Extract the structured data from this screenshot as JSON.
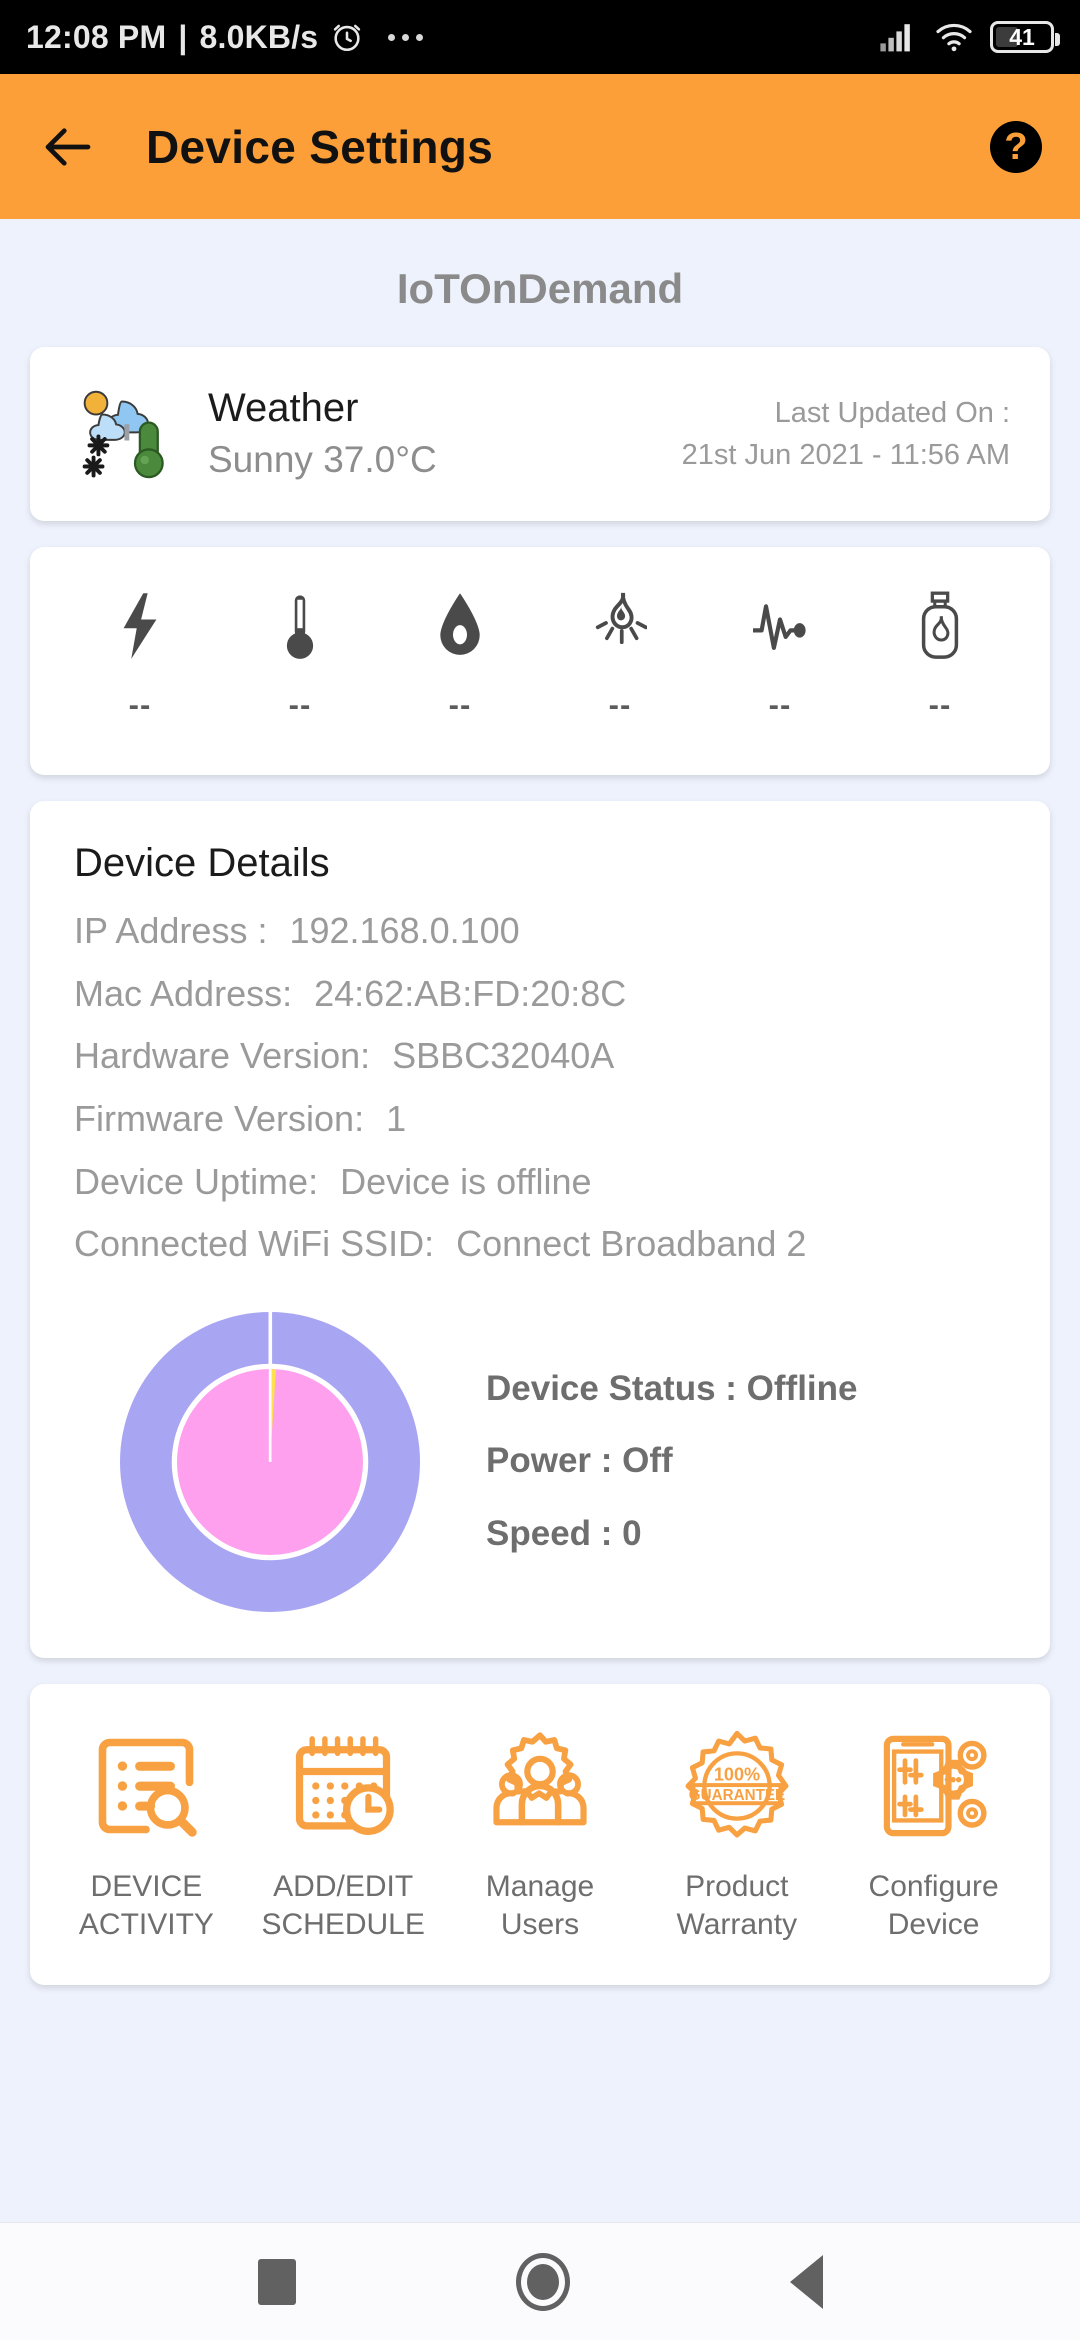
{
  "status_bar": {
    "time": "12:08 PM",
    "separator": "|",
    "network_speed": "8.0KB/s",
    "alarm_icon": "alarm-clock-icon",
    "overflow_icon": "more-dots-icon",
    "signal_icon": "cellular-signal-icon",
    "wifi_icon": "wifi-icon",
    "battery_level": "41"
  },
  "app_bar": {
    "back_icon": "back-arrow-icon",
    "title": "Device Settings",
    "help_icon": "help-circle-icon",
    "help_glyph": "?",
    "background_color": "#fc9f38"
  },
  "device_name": "IoTOnDemand",
  "weather_card": {
    "icon": "weather-sun-cloud-snow-thermometer-icon",
    "title": "Weather",
    "condition": "Sunny 37.0°C",
    "updated_label": "Last Updated On :",
    "updated_value": "21st Jun 2021 - 11:56 AM"
  },
  "sensors": [
    {
      "icon": "bolt-icon",
      "value": "--"
    },
    {
      "icon": "thermometer-icon",
      "value": "--"
    },
    {
      "icon": "water-drop-icon",
      "value": "--"
    },
    {
      "icon": "flame-rays-icon",
      "value": "--"
    },
    {
      "icon": "pulse-wave-icon",
      "value": "--"
    },
    {
      "icon": "gas-cylinder-icon",
      "value": "--"
    }
  ],
  "device_details": {
    "heading": "Device Details",
    "rows": [
      {
        "label": "IP Address :",
        "value": "192.168.0.100"
      },
      {
        "label": "Mac Address:",
        "value": "24:62:AB:FD:20:8C"
      },
      {
        "label": "Hardware Version:",
        "value": "SBBC32040A"
      },
      {
        "label": "Firmware Version:",
        "value": "1"
      },
      {
        "label": "Device Uptime:",
        "value": "Device is offline"
      },
      {
        "label": "Connected WiFi SSID:",
        "value": "Connect Broadband 2"
      }
    ],
    "status_lines": [
      "Device Status : Offline",
      "Power : Off",
      "Speed : 0"
    ]
  },
  "chart_data": {
    "type": "pie",
    "title": "",
    "rings": [
      {
        "name": "outer",
        "labels": [
          "Offline"
        ],
        "values": [
          100
        ],
        "colors": [
          "#a8a5f2"
        ]
      },
      {
        "name": "inner",
        "labels": [
          "Off",
          "On"
        ],
        "values": [
          99,
          1
        ],
        "colors": [
          "#ffa0ee",
          "#ffe14d"
        ]
      }
    ],
    "legend": "none",
    "start_angle": 90,
    "separator_color": "#ffffff"
  },
  "actions": [
    {
      "icon": "device-activity-icon",
      "label": "DEVICE\nACTIVITY"
    },
    {
      "icon": "calendar-clock-icon",
      "label": "ADD/EDIT\nSCHEDULE"
    },
    {
      "icon": "manage-users-icon",
      "label": "Manage\nUsers"
    },
    {
      "icon": "guarantee-badge-icon",
      "label": "Product\nWarranty"
    },
    {
      "icon": "configure-device-icon",
      "label": "Configure\nDevice"
    }
  ],
  "nav_bar": {
    "recents_icon": "square-recents-icon",
    "home_icon": "circle-home-icon",
    "back_icon": "triangle-back-icon"
  }
}
